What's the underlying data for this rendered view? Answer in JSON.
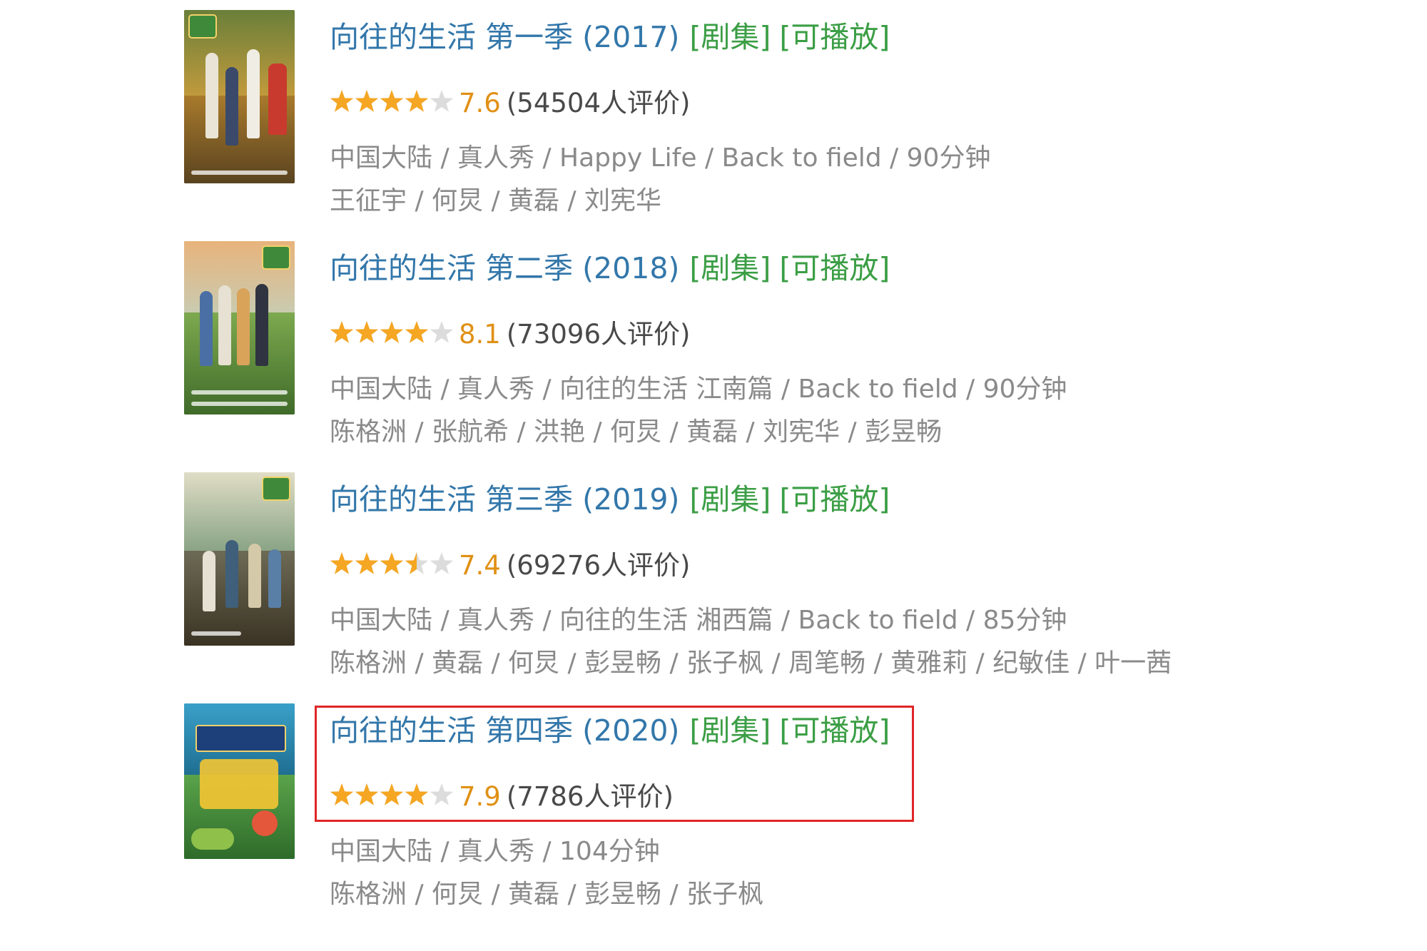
{
  "results": [
    {
      "title": "向往的生活 第一季 (2017)",
      "tag_series": "[剧集]",
      "tag_playable": "[可播放]",
      "rating": 7.6,
      "score": "7.6",
      "votes": "(54504人评价)",
      "meta1": "中国大陆 / 真人秀 / Happy Life / Back to field / 90分钟",
      "meta2": "王征宇 / 何炅 / 黄磊 / 刘宪华"
    },
    {
      "title": "向往的生活 第二季 (2018)",
      "tag_series": "[剧集]",
      "tag_playable": "[可播放]",
      "rating": 8.1,
      "score": "8.1",
      "votes": "(73096人评价)",
      "meta1": "中国大陆 / 真人秀 / 向往的生活 江南篇 / Back to field / 90分钟",
      "meta2": "陈格洲 / 张航希 / 洪艳 / 何炅 / 黄磊 / 刘宪华 / 彭昱畅"
    },
    {
      "title": "向往的生活 第三季 (2019)",
      "tag_series": "[剧集]",
      "tag_playable": "[可播放]",
      "rating": 7.4,
      "score": "7.4",
      "votes": "(69276人评价)",
      "meta1": "中国大陆 / 真人秀 / 向往的生活 湘西篇 / Back to field / 85分钟",
      "meta2": "陈格洲 / 黄磊 / 何炅 / 彭昱畅 / 张子枫 / 周笔畅 / 黄雅莉 / 纪敏佳 / 叶一茜"
    },
    {
      "title": "向往的生活 第四季 (2020)",
      "tag_series": "[剧集]",
      "tag_playable": "[可播放]",
      "rating": 7.9,
      "score": "7.9",
      "votes": "(7786人评价)",
      "meta1": "中国大陆 / 真人秀 / 104分钟",
      "meta2": "陈格洲 / 何炅 / 黄磊 / 彭昱畅 / 张子枫",
      "highlighted": true
    }
  ],
  "colors": {
    "title_link": "#3377aa",
    "tag_green": "#3b9e45",
    "score_orange": "#e09015",
    "star_fill": "#f5a623",
    "star_empty": "#dcdcdc",
    "meta_gray": "#8a8a8a",
    "highlight_red": "#e02626"
  }
}
